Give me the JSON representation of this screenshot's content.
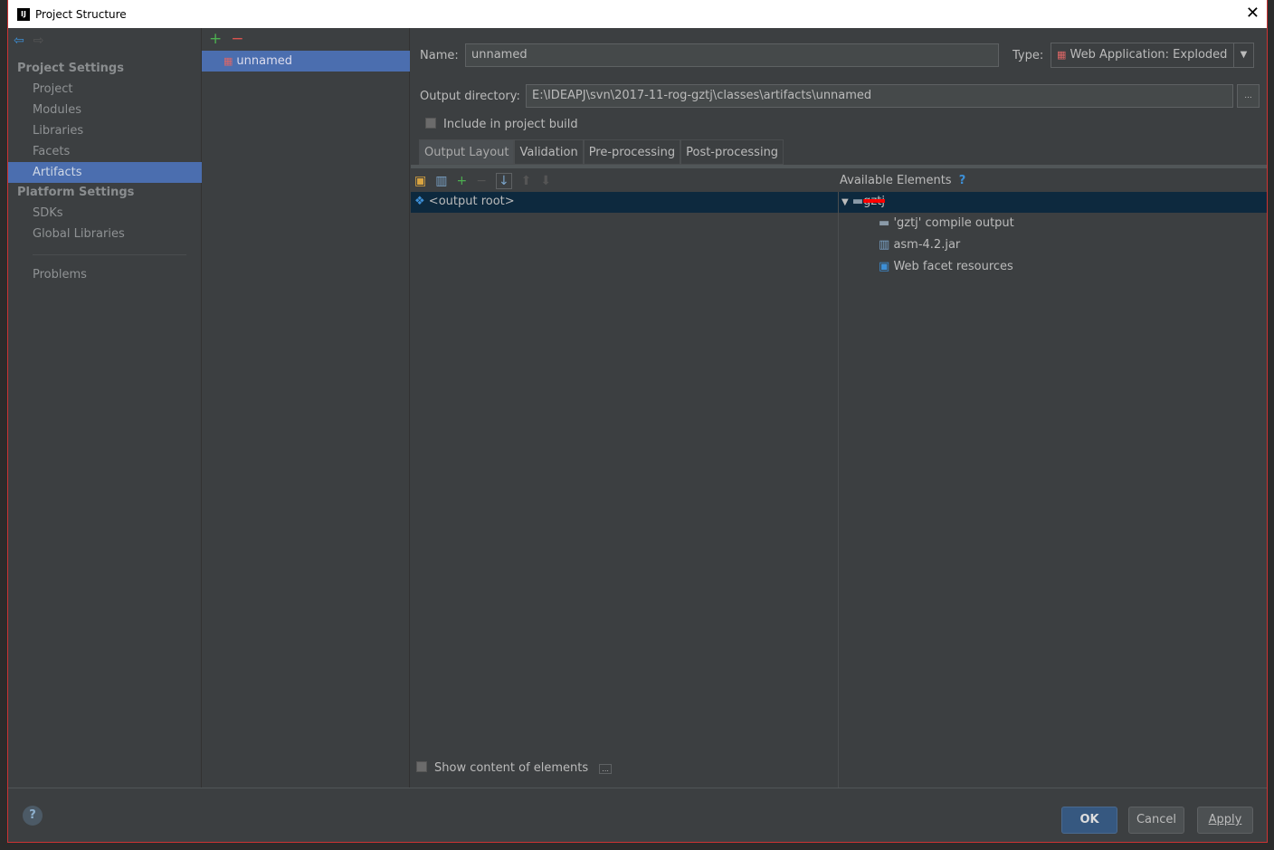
{
  "window": {
    "title": "Project Structure"
  },
  "sidebar": {
    "sections": [
      {
        "label": "Project Settings",
        "items": [
          "Project",
          "Modules",
          "Libraries",
          "Facets",
          "Artifacts"
        ]
      },
      {
        "label": "Platform Settings",
        "items": [
          "SDKs",
          "Global Libraries"
        ]
      }
    ],
    "problems": "Problems",
    "selected": "Artifacts"
  },
  "artifacts": {
    "items": [
      "unnamed"
    ]
  },
  "form": {
    "name_label": "Name:",
    "name_value": "unnamed",
    "type_label": "Type:",
    "type_value": "Web Application: Exploded",
    "output_label": "Output directory:",
    "output_value": "E:\\IDEAPJ\\svn\\2017-11-rog-gztj\\classes\\artifacts\\unnamed",
    "browse": "...",
    "include_label": "Include in project build"
  },
  "tabs": [
    "Output Layout",
    "Validation",
    "Pre-processing",
    "Post-processing"
  ],
  "layout": {
    "root": "<output root>",
    "available_label": "Available Elements",
    "help": "?",
    "module": "gztj",
    "children": [
      "'gztj' compile output",
      "asm-4.2.jar",
      "Web facet resources"
    ],
    "show_content": "Show content of elements",
    "show_more": "..."
  },
  "footer": {
    "ok": "OK",
    "cancel": "Cancel",
    "apply": "Apply",
    "help": "?"
  }
}
